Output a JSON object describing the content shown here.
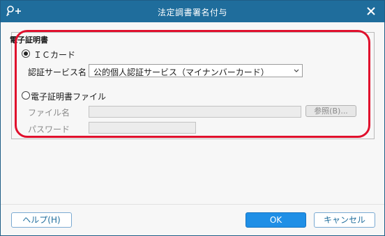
{
  "window": {
    "title": "法定調書署名付与",
    "title_icon": "key-plus-icon",
    "close_icon": "close-icon"
  },
  "certificate_group": {
    "title": "電子証明書",
    "ic_card": {
      "label": "ＩＣカード",
      "selected": true,
      "service_label": "認証サービス名",
      "service_value": "公的個人認証サービス（マイナンバーカード）"
    },
    "file": {
      "label": "電子証明書ファイル",
      "selected": false,
      "filename_label": "ファイル名",
      "filename_value": "",
      "browse_label": "参照(B)...",
      "password_label": "パスワード",
      "password_value": ""
    }
  },
  "buttons": {
    "help": "ヘルプ(H)",
    "ok": "OK",
    "cancel": "キャンセル"
  },
  "colors": {
    "titlebar": "#1f6d9c",
    "annotation": "#e0102d",
    "primary_button": "#1f8fe6"
  }
}
